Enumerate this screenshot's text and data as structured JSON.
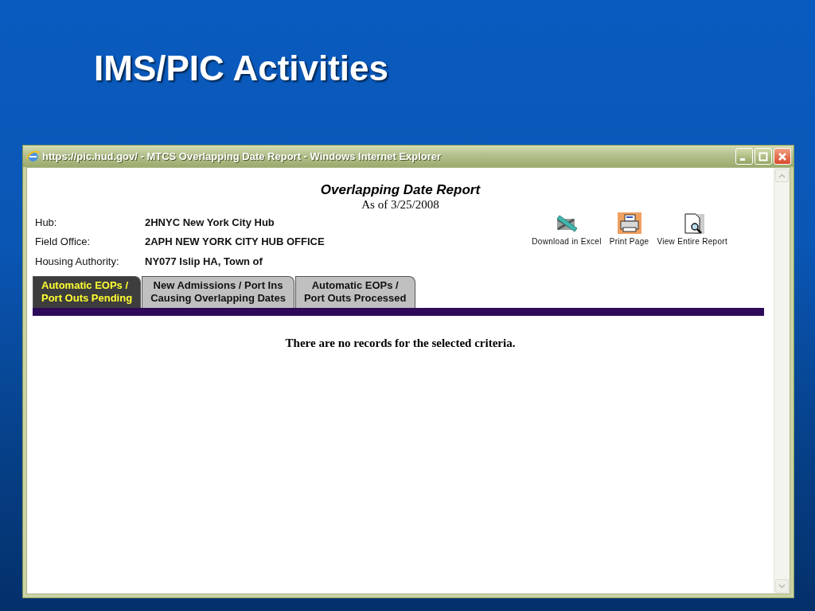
{
  "slide": {
    "title": "IMS/PIC Activities"
  },
  "window": {
    "title": "https://pic.hud.gov/ - MTCS Overlapping Date Report - Windows Internet Explorer"
  },
  "report": {
    "title": "Overlapping Date Report",
    "subtitle": "As of 3/25/2008",
    "fields": [
      {
        "label": "Hub:",
        "value": "2HNYC New York City Hub"
      },
      {
        "label": "Field Office:",
        "value": "2APH NEW YORK CITY HUB OFFICE"
      },
      {
        "label": "Housing Authority:",
        "value": "NY077 Islip HA, Town of"
      }
    ],
    "actions": [
      {
        "kind": "excel",
        "label": "Download in Excel"
      },
      {
        "kind": "print",
        "label": "Print Page"
      },
      {
        "kind": "view",
        "label": "View Entire Report"
      }
    ],
    "tabs": [
      {
        "label": "Automatic EOPs /\nPort Outs Pending",
        "selected": true
      },
      {
        "label": "New Admissions / Port Ins\nCausing Overlapping Dates",
        "selected": false
      },
      {
        "label": "Automatic EOPs /\nPort Outs Processed",
        "selected": false
      }
    ],
    "message": "There are no records for the selected criteria."
  }
}
